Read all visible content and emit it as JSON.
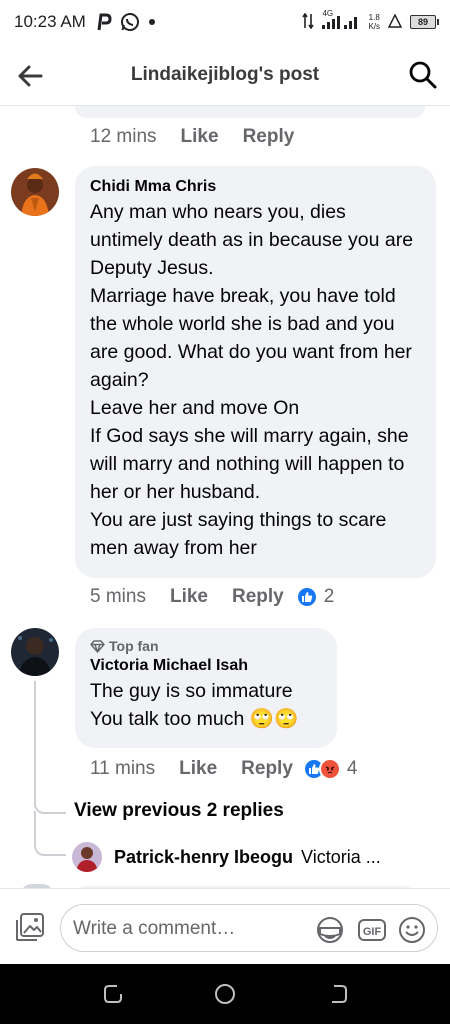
{
  "status_bar": {
    "time": "10:23 AM",
    "app_icons": [
      "pinterest-icon",
      "whatsapp-icon",
      "dot-icon"
    ],
    "network": "4G",
    "speed_value": "1.8",
    "speed_unit": "K/s",
    "battery": "89"
  },
  "header": {
    "title": "Lindaikejiblog's post"
  },
  "prev_comment": {
    "time": "12 mins",
    "like": "Like",
    "reply": "Reply"
  },
  "comments": [
    {
      "name": "Chidi Mma Chris",
      "text": "Any man who nears you, dies untimely death as in because you are Deputy Jesus.\nMarriage have break, you have told the whole world she is bad and you are good. What do you want from her again?\nLeave her and move On\nIf God says she will marry again, she will marry and nothing will happen to her or her husband.\nYou are just saying things to scare men away from her",
      "time": "5 mins",
      "like": "Like",
      "reply": "Reply",
      "reactions": [
        "like"
      ],
      "reaction_count": "2"
    },
    {
      "badge": "Top fan",
      "name": "Victoria Michael Isah",
      "text": "The guy is so immature\nYou talk too much 🙄🙄",
      "time": "11 mins",
      "like": "Like",
      "reply": "Reply",
      "reactions": [
        "like",
        "angry"
      ],
      "reaction_count": "4"
    }
  ],
  "thread": {
    "view_previous": "View previous 2 replies",
    "reply_name": "Patrick-henry Ibeogu",
    "reply_text": "Victoria ..."
  },
  "composer": {
    "placeholder": "Write a comment…"
  },
  "colors": {
    "accent": "#1877f2",
    "bubble": "#f0f2f5",
    "meta_text": "#65676b",
    "angry": "#f0533c"
  }
}
